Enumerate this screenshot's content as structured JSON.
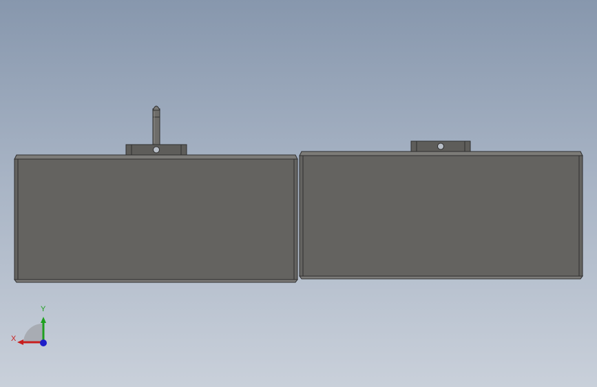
{
  "viewport": {
    "background_top": "#8797ad",
    "background_bottom": "#c9d0da"
  },
  "model": {
    "body_color": "#646360",
    "edge_color": "#2e2e2e",
    "bevel_color": "#7c7b78",
    "bracket_color": "#5e5d5a",
    "knob_color": "#6e6d6a",
    "parts": [
      {
        "name": "left-enclosure",
        "has_knob": true
      },
      {
        "name": "right-enclosure",
        "has_knob": false
      }
    ]
  },
  "triad": {
    "x_label": "X",
    "y_label": "Y",
    "x_color": "#c81e1e",
    "y_color": "#1ea01e",
    "z_color": "#1e1ec8"
  }
}
